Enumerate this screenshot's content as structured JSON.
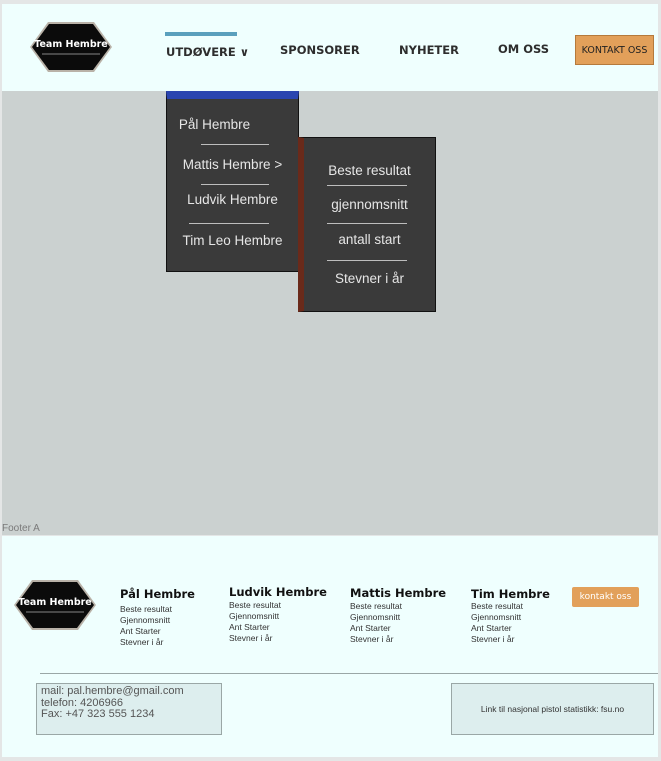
{
  "brand": {
    "logo_text": "Team Hembre"
  },
  "nav": {
    "items": [
      {
        "label": "UTDØVERE ∨"
      },
      {
        "label": "SPONSORER"
      },
      {
        "label": "NYHETER"
      },
      {
        "label": "OM OSS"
      }
    ],
    "contact_label": "KONTAKT OSS"
  },
  "dropdown": {
    "athletes": [
      "Pål Hembre",
      "Mattis Hembre  >",
      "Ludvik Hembre",
      "Tim Leo Hembre"
    ],
    "submenu": [
      "Beste resultat",
      "gjennomsnitt",
      "antall start",
      "Stevner i år"
    ]
  },
  "footer_label": "Footer A",
  "footer": {
    "logo_text": "Team Hembre",
    "columns": [
      {
        "name": "Pål Hembre",
        "lines": [
          "Beste resultat",
          "Gjennomsnitt",
          "Ant Starter",
          "Stevner i år"
        ]
      },
      {
        "name": "Ludvik Hembre",
        "lines": [
          "Beste resultat",
          "Gjennomsnitt",
          "Ant Starter",
          "Stevner i år"
        ]
      },
      {
        "name": "Mattis Hembre",
        "lines": [
          "Beste resultat",
          "Gjennomsnitt",
          "Ant Starter",
          "Stevner i år"
        ]
      },
      {
        "name": "Tim Hembre",
        "lines": [
          "Beste resultat",
          "Gjennomsnitt",
          "Ant Starter",
          "Stevner i år"
        ]
      }
    ],
    "contact_label": "kontakt oss",
    "contact_info": [
      "mail: pal.hembre@gmail.com",
      "telefon: 4206966",
      "Fax: +47 323 555 1234"
    ],
    "link_text": "Link til nasjonal pistol statistikk: fsu.no"
  },
  "colors": {
    "accent_orange": "#e2a05a",
    "nav_active_bar": "#5aa0bd",
    "menu_top_bar": "#2a45b0",
    "submenu_accent": "#6a2a1a",
    "header_bg": "#effffe",
    "content_bg": "#cbd1d0"
  }
}
